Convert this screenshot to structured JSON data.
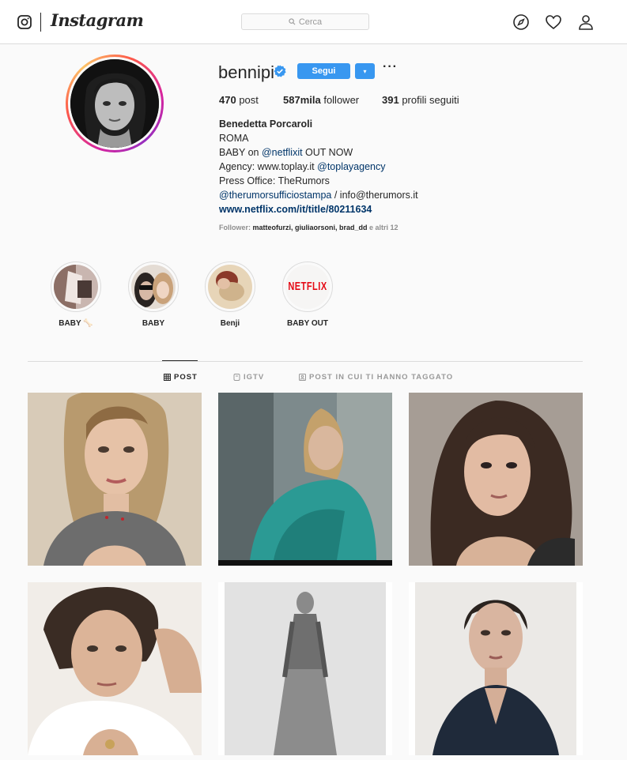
{
  "nav": {
    "wordmark": "Instagram",
    "search_placeholder": "Cerca"
  },
  "profile": {
    "username": "bennipi",
    "follow_label": "Segui",
    "dropdown_glyph": "▾",
    "more_glyph": "···",
    "stats": [
      {
        "value": "470",
        "label": "post"
      },
      {
        "value": "587mila",
        "label": "follower"
      },
      {
        "value": "391",
        "label": "profili seguiti"
      }
    ],
    "bio": {
      "name": "Benedetta Porcaroli",
      "line1": "ROMA",
      "line2_pre": "BABY on ",
      "line2_mention": "@netflixit",
      "line2_post": " OUT NOW",
      "line3_pre": "Agency: www.toplay.it ",
      "line3_mention": "@toplayagency",
      "line4": "Press Office: TheRumors",
      "line5_mention": "@therumorsufficiostampa",
      "line5_post": " / info@therumors.it",
      "link": "www.netflix.com/it/title/80211634"
    },
    "followed_by": {
      "prefix": "Follower: ",
      "names": "matteofurzi, giuliaorsoni, brad_dd",
      "suffix": " e altri 12"
    }
  },
  "highlights": [
    {
      "label": "BABY 🦴"
    },
    {
      "label": "BABY"
    },
    {
      "label": "Benji"
    },
    {
      "label": "BABY OUT",
      "logo_text": "NETFLIX"
    }
  ],
  "tabs": [
    {
      "label": "POST",
      "icon": "grid-icon",
      "active": true
    },
    {
      "label": "IGTV",
      "icon": "tv-icon",
      "active": false
    },
    {
      "label": "POST IN CUI TI HANNO TAGGATO",
      "icon": "tagged-icon",
      "active": false
    }
  ],
  "colors": {
    "accent": "#3897f0",
    "link": "#003569",
    "verified": "#3897f0",
    "netflix": "#e50914"
  }
}
